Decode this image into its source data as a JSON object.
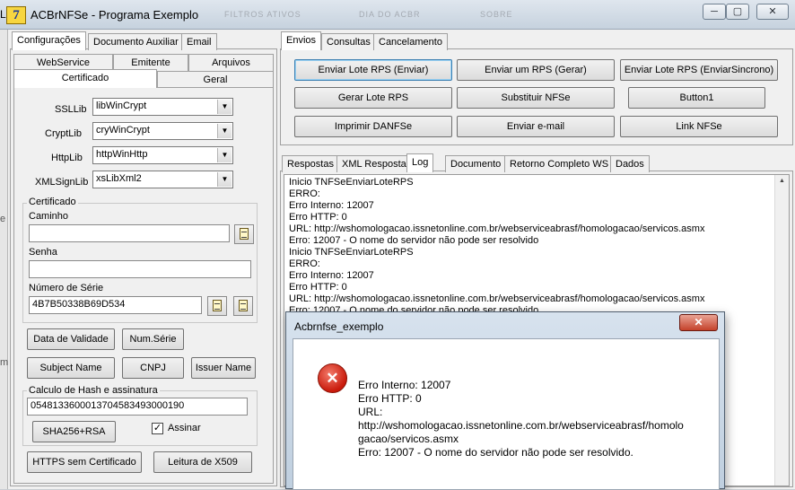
{
  "window": {
    "title": "ACBrNFSe - Programa Exemplo",
    "ghost_tabs": [
      "FILTROS ATIVOS",
      "DIA DO ACBR",
      "SOBRE"
    ],
    "controls": {
      "minimize": "─",
      "maximize": "▢",
      "close": "✕"
    },
    "left_edge_chars": [
      "L",
      "e",
      "m"
    ]
  },
  "left": {
    "tabs": [
      "Configurações",
      "Documento Auxiliar",
      "Email"
    ],
    "subtabs_row1": [
      "WebService",
      "Emitente",
      "Arquivos"
    ],
    "subtabs_row2": [
      "Certificado",
      "Geral"
    ],
    "fields": {
      "ssllib": {
        "label": "SSLLib",
        "value": "libWinCrypt"
      },
      "cryptlib": {
        "label": "CryptLib",
        "value": "cryWinCrypt"
      },
      "httplib": {
        "label": "HttpLib",
        "value": "httpWinHttp"
      },
      "xmlsignlib": {
        "label": "XMLSignLib",
        "value": "xsLibXml2"
      }
    },
    "certificado": {
      "group_title": "Certificado",
      "caminho_label": "Caminho",
      "caminho_value": "",
      "senha_label": "Senha",
      "senha_value": "",
      "serie_label": "Número de Série",
      "serie_value": "4B7B50338B69D534"
    },
    "buttons": {
      "data_validade": "Data de Validade",
      "num_serie": "Num.Série",
      "subject_name": "Subject Name",
      "cnpj": "CNPJ",
      "issuer_name": "Issuer Name",
      "sha256": "SHA256+RSA",
      "https_sem_cert": "HTTPS sem Certificado",
      "leitura_x509": "Leitura de X509"
    },
    "hash": {
      "group_title": "Calculo de Hash e assinatura",
      "value": "05481336000137045834930001​90",
      "assinar_label": "Assinar",
      "assinar_checked": "✓"
    }
  },
  "right": {
    "tabs": [
      "Envios",
      "Consultas",
      "Cancelamento"
    ],
    "buttons": [
      "Enviar Lote RPS (Enviar)",
      "Enviar um RPS (Gerar)",
      "Enviar Lote RPS (EnviarSincrono)",
      "Gerar Lote RPS",
      "Substituir NFSe",
      "Button1",
      "Imprimir DANFSe",
      "Enviar e-mail",
      "Link NFSe"
    ],
    "lower_tabs": [
      "Respostas",
      "XML Resposta",
      "Log",
      "Documento",
      "Retorno Completo WS",
      "Dados"
    ],
    "log_lines": [
      "Inicio TNFSeEnviarLoteRPS",
      "ERRO:",
      "Erro Interno: 12007",
      "Erro HTTP: 0",
      "URL: http://wshomologacao.issnetonline.com.br/webserviceabrasf/homologacao/servicos.asmx",
      "Erro: 12007 - O nome do servidor não pode ser resolvido",
      "Inicio TNFSeEnviarLoteRPS",
      "ERRO:",
      "Erro Interno: 12007",
      "Erro HTTP: 0",
      "URL: http://wshomologacao.issnetonline.com.br/webserviceabrasf/homologacao/servicos.asmx",
      "Erro: 12007 - O nome do servidor não pode ser resolvido"
    ]
  },
  "dialog": {
    "title": "Acbrnfse_exemplo",
    "close": "✕",
    "icon": "✕",
    "lines": [
      "Erro Interno: 12007",
      "Erro HTTP: 0",
      "URL:",
      "http://wshomologacao.issnetonline.com.br/webserviceabrasf/homolo",
      "gacao/servicos.asmx",
      "Erro: 12007 - O nome do servidor não pode ser resolvido."
    ]
  }
}
